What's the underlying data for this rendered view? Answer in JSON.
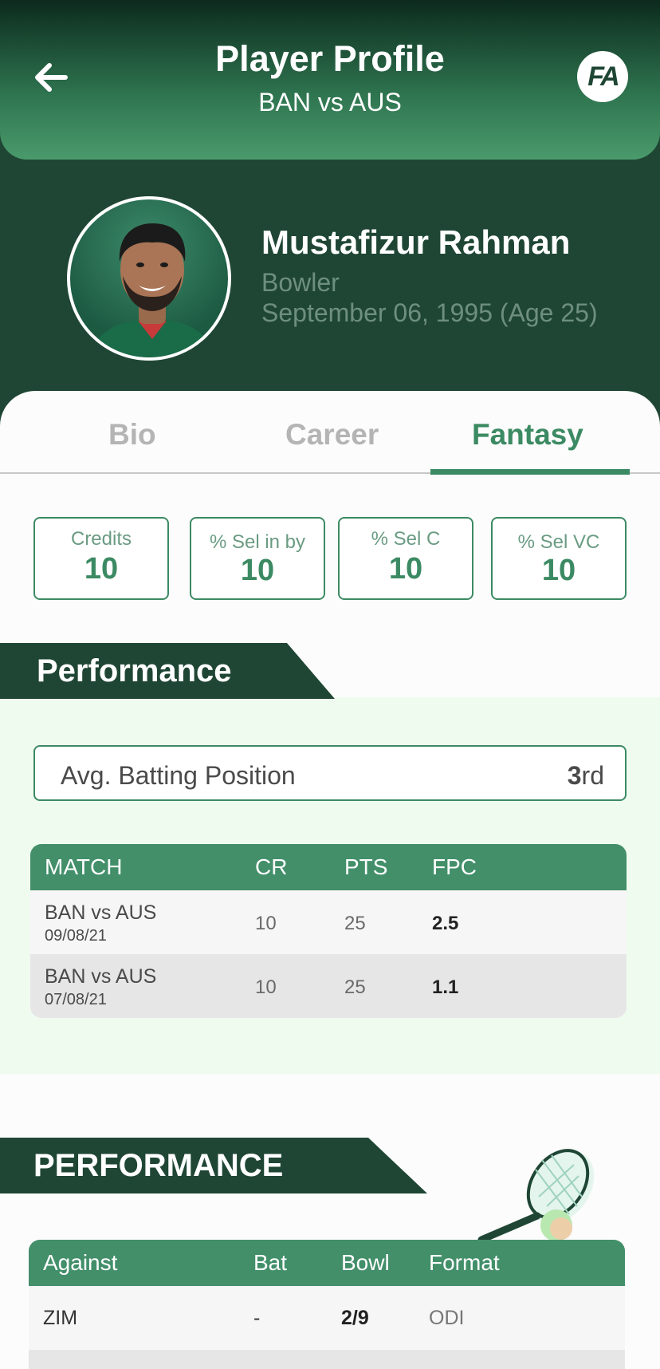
{
  "header": {
    "title": "Player Profile",
    "subtitle": "BAN vs AUS",
    "logo_text": "FA"
  },
  "player": {
    "name": "Mustafizur Rahman",
    "role": "Bowler",
    "dob": "September 06, 1995 (Age 25)"
  },
  "tabs": [
    {
      "label": "Bio",
      "active": false
    },
    {
      "label": "Career",
      "active": false
    },
    {
      "label": "Fantasy",
      "active": true
    }
  ],
  "stats": [
    {
      "label": "Credits",
      "value": "10"
    },
    {
      "label": "% Sel in by",
      "value": "10"
    },
    {
      "label": "% Sel C",
      "value": "10"
    },
    {
      "label": "% Sel VC",
      "value": "10"
    }
  ],
  "performance": {
    "title": "Performance",
    "avg_batting_label": "Avg. Batting Position",
    "avg_batting_value": "3",
    "avg_batting_suffix": "rd",
    "columns": [
      "MATCH",
      "CR",
      "PTS",
      "FPC"
    ],
    "rows": [
      {
        "match": "BAN vs AUS",
        "date": "09/08/21",
        "cr": "10",
        "pts": "25",
        "fpc": "2.5"
      },
      {
        "match": "BAN vs AUS",
        "date": "07/08/21",
        "cr": "10",
        "pts": "25",
        "fpc": "1.1"
      }
    ]
  },
  "performance2": {
    "title": "PERFORMANCE",
    "columns": [
      "Against",
      "Bat",
      "Bowl",
      "Format"
    ],
    "rows": [
      {
        "against": "ZIM",
        "bat": "-",
        "bowl": "2/9",
        "format": "ODI"
      }
    ]
  },
  "colors": {
    "primary": "#3c8a63",
    "dark": "#1f4634",
    "header_light": "#4a9a6c"
  }
}
